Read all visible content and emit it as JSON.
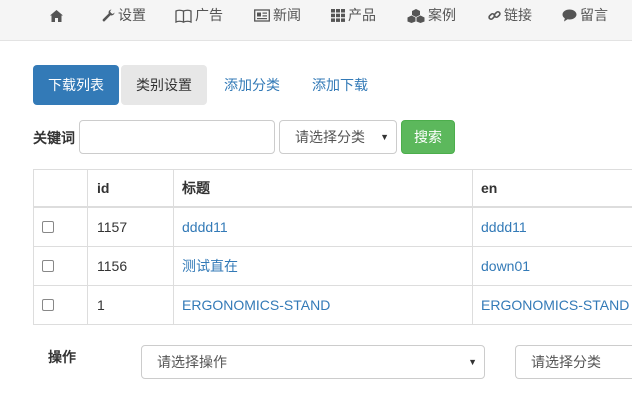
{
  "nav": {
    "items": [
      {
        "label": "",
        "icon": "home-icon"
      },
      {
        "label": "设置",
        "icon": "wrench-icon"
      },
      {
        "label": "广告",
        "icon": "book-icon"
      },
      {
        "label": "新闻",
        "icon": "newspaper-icon"
      },
      {
        "label": "产品",
        "icon": "grid-icon"
      },
      {
        "label": "案例",
        "icon": "cubes-icon"
      },
      {
        "label": "链接",
        "icon": "link-icon"
      },
      {
        "label": "留言",
        "icon": "comment-icon"
      }
    ]
  },
  "tabs": {
    "download_list": "下载列表",
    "category_settings": "类别设置",
    "add_category": "添加分类",
    "add_download": "添加下载"
  },
  "search": {
    "keyword_label": "关键词",
    "keyword_value": "",
    "category_select": "请选择分类",
    "search_button": "搜索"
  },
  "table": {
    "headers": {
      "id": "id",
      "title": "标题",
      "en": "en"
    },
    "rows": [
      {
        "id": "1157",
        "title": "dddd11",
        "en": "dddd11"
      },
      {
        "id": "1156",
        "title": "测试直在",
        "en": "down01"
      },
      {
        "id": "1",
        "title": "ERGONOMICS-STAND",
        "en": "ERGONOMICS-STAND"
      }
    ]
  },
  "footer": {
    "operation_label": "操作",
    "operation_select": "请选择操作",
    "category_select": "请选择分类"
  },
  "colors": {
    "primary": "#337ab7",
    "success": "#5cb85c",
    "nav_bg": "#f5f5f5"
  }
}
